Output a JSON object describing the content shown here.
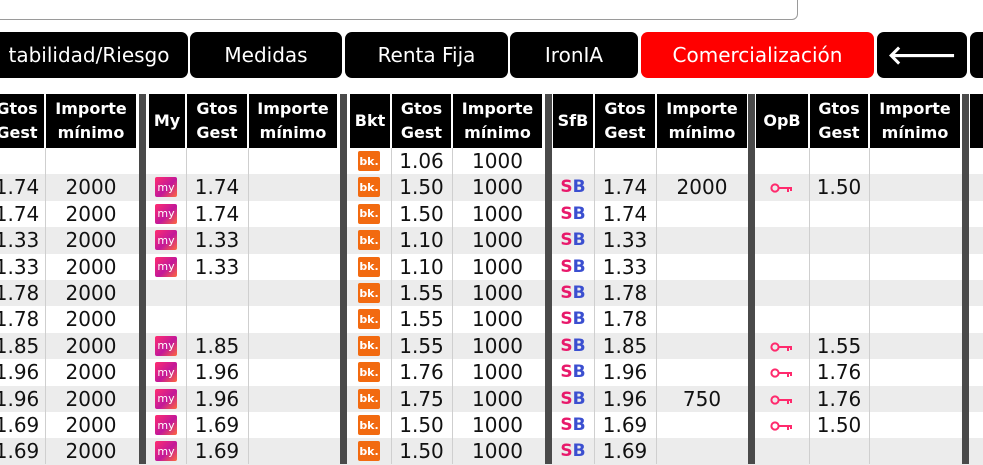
{
  "tabs": [
    {
      "label": "tabilidad/Riesgo",
      "active": false
    },
    {
      "label": "Medidas",
      "active": false
    },
    {
      "label": "Renta Fija",
      "active": false
    },
    {
      "label": "IronIA",
      "active": false
    },
    {
      "label": "Comercialización",
      "active": true
    }
  ],
  "back_tab_icon": "arrow-left-icon",
  "headers": {
    "gtos": [
      "Gtos",
      "Gest"
    ],
    "importe": [
      "Importe",
      "mínimo"
    ],
    "gtos_partial": [
      "Gtos",
      "Gest"
    ],
    "my": "My",
    "bkt": "Bkt",
    "sfb": "SfB",
    "opb": "OpB"
  },
  "icons": {
    "my": {
      "name": "myinvestor-icon",
      "text": "my"
    },
    "bk": {
      "name": "bankinter-icon",
      "text": "bk."
    },
    "sb": {
      "name": "selfbank-icon",
      "s": "S",
      "b": "B"
    },
    "opb": {
      "name": "openbank-key-icon"
    }
  },
  "colors": {
    "active_tab": "#ff0000",
    "tab": "#000000",
    "alt_row": "#ececec"
  },
  "rows": [
    {
      "g0": "",
      "i0": "",
      "my": false,
      "g1": "",
      "i1": "",
      "bk": true,
      "g2": "1.06",
      "i2": "1000",
      "sb": false,
      "g3": "",
      "i3": "",
      "opb": false,
      "g4": ""
    },
    {
      "g0": "1.74",
      "i0": "2000",
      "my": true,
      "g1": "1.74",
      "i1": "",
      "bk": true,
      "g2": "1.50",
      "i2": "1000",
      "sb": true,
      "g3": "1.74",
      "i3": "2000",
      "opb": true,
      "g4": "1.50"
    },
    {
      "g0": "1.74",
      "i0": "2000",
      "my": true,
      "g1": "1.74",
      "i1": "",
      "bk": true,
      "g2": "1.50",
      "i2": "1000",
      "sb": true,
      "g3": "1.74",
      "i3": "",
      "opb": false,
      "g4": ""
    },
    {
      "g0": "1.33",
      "i0": "2000",
      "my": true,
      "g1": "1.33",
      "i1": "",
      "bk": true,
      "g2": "1.10",
      "i2": "1000",
      "sb": true,
      "g3": "1.33",
      "i3": "",
      "opb": false,
      "g4": ""
    },
    {
      "g0": "1.33",
      "i0": "2000",
      "my": true,
      "g1": "1.33",
      "i1": "",
      "bk": true,
      "g2": "1.10",
      "i2": "1000",
      "sb": true,
      "g3": "1.33",
      "i3": "",
      "opb": false,
      "g4": ""
    },
    {
      "g0": "1.78",
      "i0": "2000",
      "my": false,
      "g1": "",
      "i1": "",
      "bk": true,
      "g2": "1.55",
      "i2": "1000",
      "sb": true,
      "g3": "1.78",
      "i3": "",
      "opb": false,
      "g4": ""
    },
    {
      "g0": "1.78",
      "i0": "2000",
      "my": false,
      "g1": "",
      "i1": "",
      "bk": true,
      "g2": "1.55",
      "i2": "1000",
      "sb": true,
      "g3": "1.78",
      "i3": "",
      "opb": false,
      "g4": ""
    },
    {
      "g0": "1.85",
      "i0": "2000",
      "my": true,
      "g1": "1.85",
      "i1": "",
      "bk": true,
      "g2": "1.55",
      "i2": "1000",
      "sb": true,
      "g3": "1.85",
      "i3": "",
      "opb": true,
      "g4": "1.55"
    },
    {
      "g0": "1.96",
      "i0": "2000",
      "my": true,
      "g1": "1.96",
      "i1": "",
      "bk": true,
      "g2": "1.76",
      "i2": "1000",
      "sb": true,
      "g3": "1.96",
      "i3": "",
      "opb": true,
      "g4": "1.76"
    },
    {
      "g0": "1.96",
      "i0": "2000",
      "my": true,
      "g1": "1.96",
      "i1": "",
      "bk": true,
      "g2": "1.75",
      "i2": "1000",
      "sb": true,
      "g3": "1.96",
      "i3": "750",
      "opb": true,
      "g4": "1.76"
    },
    {
      "g0": "1.69",
      "i0": "2000",
      "my": true,
      "g1": "1.69",
      "i1": "",
      "bk": true,
      "g2": "1.50",
      "i2": "1000",
      "sb": true,
      "g3": "1.69",
      "i3": "",
      "opb": true,
      "g4": "1.50"
    },
    {
      "g0": "1.69",
      "i0": "2000",
      "my": true,
      "g1": "1.69",
      "i1": "",
      "bk": true,
      "g2": "1.50",
      "i2": "1000",
      "sb": true,
      "g3": "1.69",
      "i3": "",
      "opb": false,
      "g4": ""
    }
  ]
}
